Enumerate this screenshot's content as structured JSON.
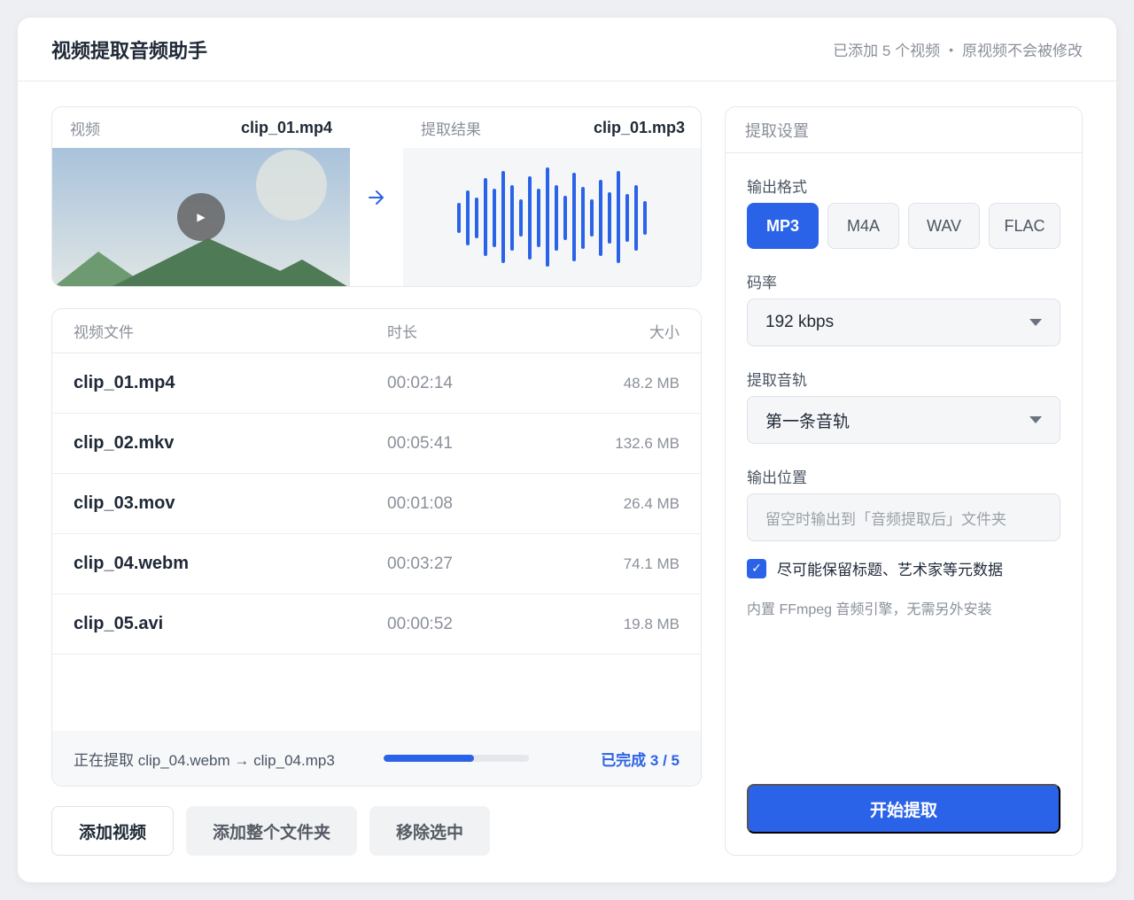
{
  "header": {
    "title": "视频提取音频助手",
    "info_count": "已添加 5 个视频",
    "info_separator": "•",
    "info_note": "原视频不会被修改"
  },
  "preview": {
    "video_label": "视频",
    "video_file": "clip_01.mp4",
    "result_label": "提取结果",
    "result_file": "clip_01.mp3",
    "arrow_icon": "arrow-right-icon",
    "play_icon": "play-icon"
  },
  "table": {
    "headers": {
      "name": "视频文件",
      "duration": "时长",
      "size": "大小"
    },
    "rows": [
      {
        "name": "clip_01.mp4",
        "duration": "00:02:14",
        "size": "48.2 MB"
      },
      {
        "name": "clip_02.mkv",
        "duration": "00:05:41",
        "size": "132.6 MB"
      },
      {
        "name": "clip_03.mov",
        "duration": "00:01:08",
        "size": "26.4 MB"
      },
      {
        "name": "clip_04.webm",
        "duration": "00:03:27",
        "size": "74.1 MB"
      },
      {
        "name": "clip_05.avi",
        "duration": "00:00:52",
        "size": "19.8 MB"
      }
    ],
    "status": {
      "text": "正在提取 clip_04.webm → clip_04.mp3",
      "progress": 0.62,
      "count": "已完成 3 / 5"
    }
  },
  "actions": {
    "add_video": "添加视频",
    "add_folder": "添加整个文件夹",
    "remove_selected": "移除选中"
  },
  "settings": {
    "title": "提取设置",
    "format_label": "输出格式",
    "formats": [
      "MP3",
      "M4A",
      "WAV",
      "FLAC"
    ],
    "selected_format": "MP3",
    "bitrate_label": "码率",
    "bitrate_value": "192 kbps",
    "track_label": "提取音轨",
    "track_value": "第一条音轨",
    "output_label": "输出位置",
    "output_placeholder": "留空时输出到「音频提取后」文件夹",
    "metadata_checkbox": "尽可能保留标题、艺术家等元数据",
    "metadata_checked": true,
    "hint": "内置 FFmpeg 音频引擎，无需另外安装",
    "start_button": "开始提取"
  },
  "colors": {
    "accent": "#2b63e8",
    "mountain_dark": "#4e7a55",
    "mountain_light": "#6e9a72"
  }
}
